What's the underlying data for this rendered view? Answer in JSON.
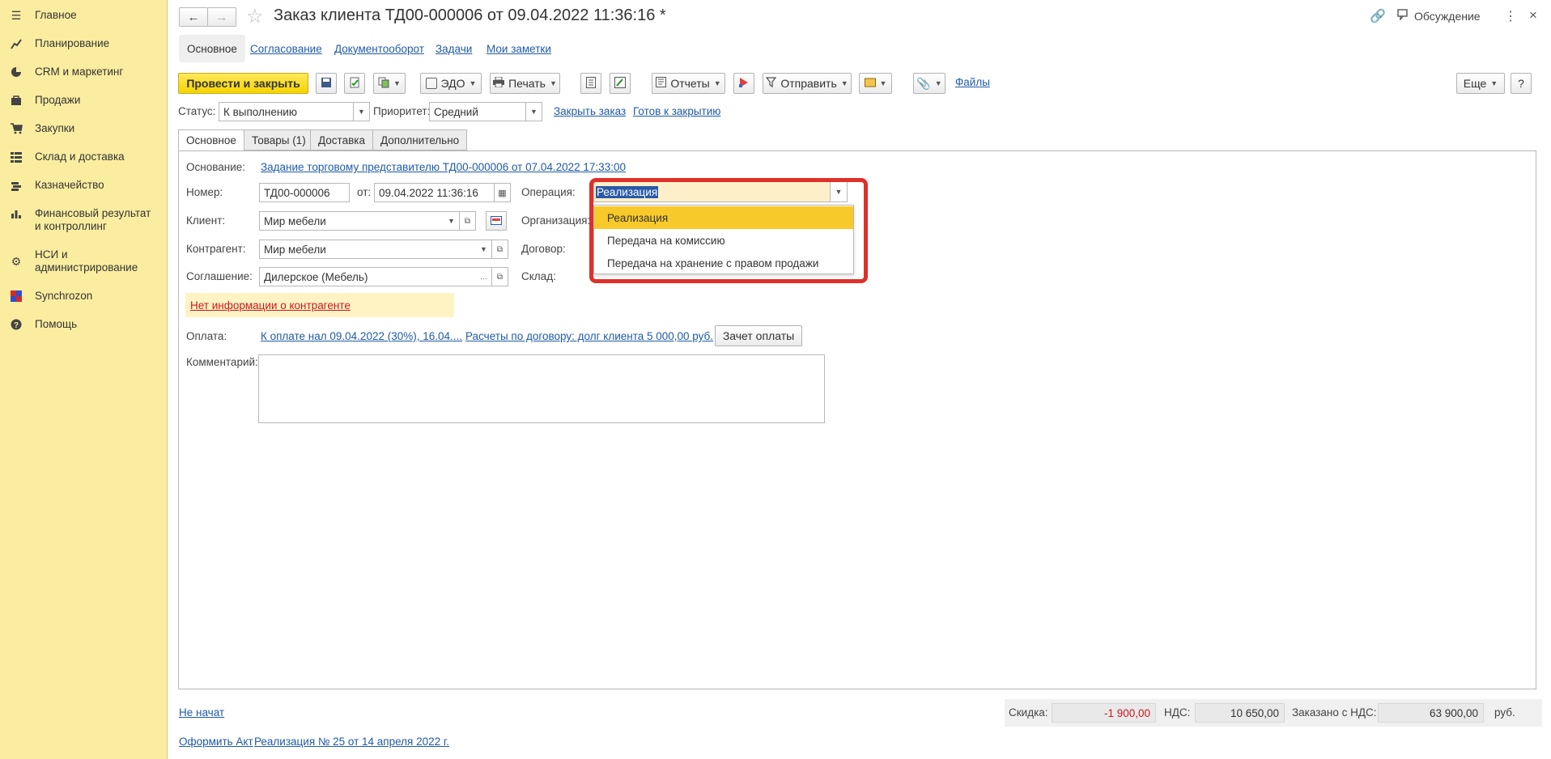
{
  "sidebar": {
    "items": [
      {
        "icon": "menu-icon",
        "label": "Главное"
      },
      {
        "icon": "planning-icon",
        "label": "Планирование"
      },
      {
        "icon": "pie-chart-icon",
        "label": "CRM и маркетинг"
      },
      {
        "icon": "shopping-bag-icon",
        "label": "Продажи"
      },
      {
        "icon": "cart-icon",
        "label": "Закупки"
      },
      {
        "icon": "warehouse-grid-icon",
        "label": "Склад и доставка"
      },
      {
        "icon": "treasury-icon",
        "label": "Казначейство"
      },
      {
        "icon": "bar-chart-icon",
        "label": "Финансовый результат и контроллинг"
      },
      {
        "icon": "gear-icon",
        "label": "НСИ и администрирование"
      },
      {
        "icon": "synchrozon-logo-icon",
        "label": "Synchrozon"
      },
      {
        "icon": "help-icon",
        "label": "Помощь"
      }
    ]
  },
  "header": {
    "title": "Заказ клиента ТД00-000006 от 09.04.2022 11:36:16 *",
    "discussion_label": "Обсуждение"
  },
  "section_tabs": [
    "Основное",
    "Согласование",
    "Документооборот",
    "Задачи",
    "Мои заметки"
  ],
  "toolbar": {
    "post_close": "Провести и закрыть",
    "edo": "ЭДО",
    "print": "Печать",
    "reports": "Отчеты",
    "send": "Отправить",
    "files": "Файлы",
    "more": "Еще",
    "help": "?"
  },
  "status_row": {
    "status_label": "Статус:",
    "status_value": "К выполнению",
    "priority_label": "Приоритет:",
    "priority_value": "Средний",
    "close_order": "Закрыть заказ",
    "ready_to_close": "Готов к закрытию"
  },
  "inner_tabs": [
    "Основное",
    "Товары (1)",
    "Доставка",
    "Дополнительно"
  ],
  "form": {
    "basis_label": "Основание:",
    "basis_link": "Задание торговому представителю ТД00-000006 от 07.04.2022 17:33:00",
    "number_label": "Номер:",
    "number_value": "ТД00-000006",
    "date_label": "от:",
    "date_value": "09.04.2022 11:36:16",
    "operation_label": "Операция:",
    "operation_value": "Реализация",
    "client_label": "Клиент:",
    "client_value": "Мир мебели",
    "organization_label": "Организация:",
    "counterparty_label": "Контрагент:",
    "counterparty_value": "Мир мебели",
    "contract_label": "Договор:",
    "agreement_label": "Соглашение:",
    "agreement_value": "Дилерское (Мебель)",
    "warehouse_label": "Склад:",
    "warning_link": "Нет информации о контрагенте",
    "payment_label": "Оплата:",
    "payment_link": "К оплате нал 09.04.2022 (30%), 16.04....",
    "settlements_link": "Расчеты по договору: долг клиента 5 000,00 руб.",
    "payment_offset": "Зачет оплаты",
    "comment_label": "Комментарий:"
  },
  "dropdown": {
    "options": [
      "Реализация",
      "Передача на комиссию",
      "Передача на хранение с правом продажи"
    ],
    "selected_index": 0
  },
  "footer": {
    "status_link": "Не начат",
    "act_link": "Оформить Акт",
    "sale_link": "Реализация № 25 от 14 апреля 2022 г.",
    "discount_label": "Скидка:",
    "discount_value": "-1 900,00",
    "vat_label": "НДС:",
    "vat_value": "10 650,00",
    "total_label": "Заказано с НДС:",
    "total_value": "63 900,00",
    "currency": "руб."
  },
  "colors": {
    "sidebar_bg": "#fbeda0",
    "primary_button": "#f5d400",
    "highlight_border": "#e0302a",
    "selected_option": "#f8c92a",
    "link": "#1f5ba8",
    "warning_text": "#d0161c"
  }
}
